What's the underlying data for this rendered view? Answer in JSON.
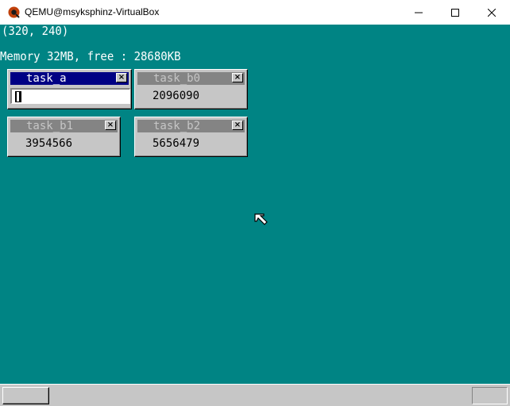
{
  "host_window": {
    "title": "QEMU@msyksphinz-VirtualBox",
    "controls": [
      "minimize",
      "maximize",
      "close"
    ]
  },
  "screen": {
    "background": "#008484",
    "mouse_coords": "(320, 240)",
    "memory_text": "Memory 32MB, free : 28680KB"
  },
  "windows": {
    "task_a": {
      "title": "task_a",
      "close": "×",
      "active": true,
      "input_value": ""
    },
    "task_b0": {
      "title": "task_b0",
      "close": "×",
      "value": "2096090"
    },
    "task_b1": {
      "title": "task_b1",
      "close": "×",
      "value": "3954566"
    },
    "task_b2": {
      "title": "task_b2",
      "close": "×",
      "value": "5656479"
    }
  },
  "colors": {
    "active_title": "#000084",
    "inactive_title": "#848484",
    "window_face": "#c6c6c6"
  },
  "taskbar": {
    "start_button": "",
    "tray": ""
  }
}
